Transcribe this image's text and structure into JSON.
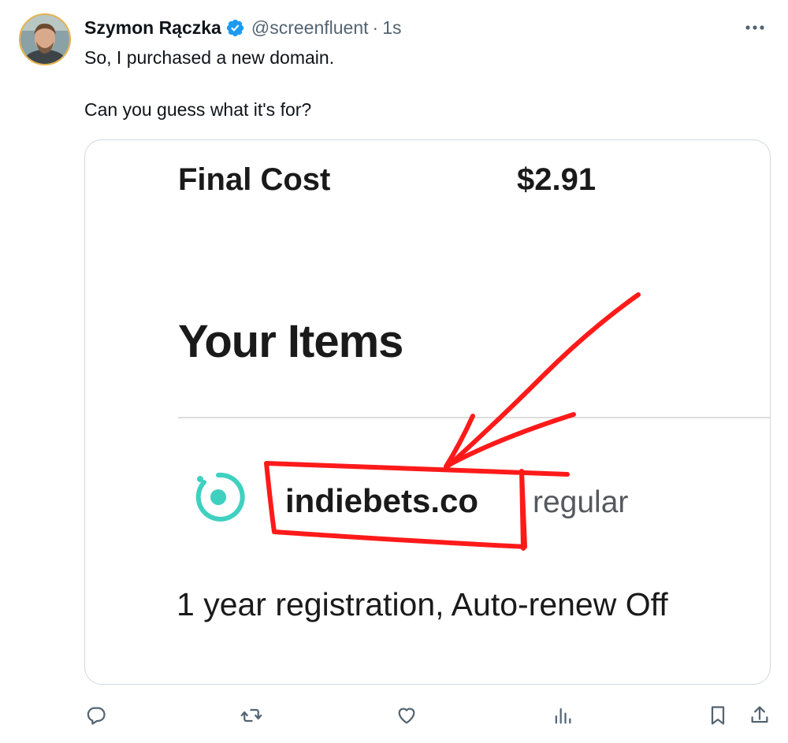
{
  "tweet": {
    "author_name": "Szymon Rączka",
    "handle": "@screenfluent",
    "separator": "·",
    "time": "1s",
    "text_line1": "So, I purchased a new domain.",
    "text_line2": "Can you guess what it's for?"
  },
  "card": {
    "final_cost_label": "Final Cost",
    "final_cost_value": "$2.91",
    "items_title": "Your Items",
    "domain_name": "indiebets.co",
    "domain_type": "regular",
    "registration": "1 year registration, Auto-renew Off"
  },
  "icons": {
    "verified": "verified-badge-icon",
    "more": "more-icon",
    "reply": "reply-icon",
    "retweet": "retweet-icon",
    "like": "like-icon",
    "views": "views-icon",
    "bookmark": "bookmark-icon",
    "share": "share-icon"
  },
  "colors": {
    "verified_blue": "#1d9bf0",
    "annotation_red": "#ff1a1a",
    "domain_icon_teal": "#3fd0c0",
    "muted_text": "#536471"
  }
}
